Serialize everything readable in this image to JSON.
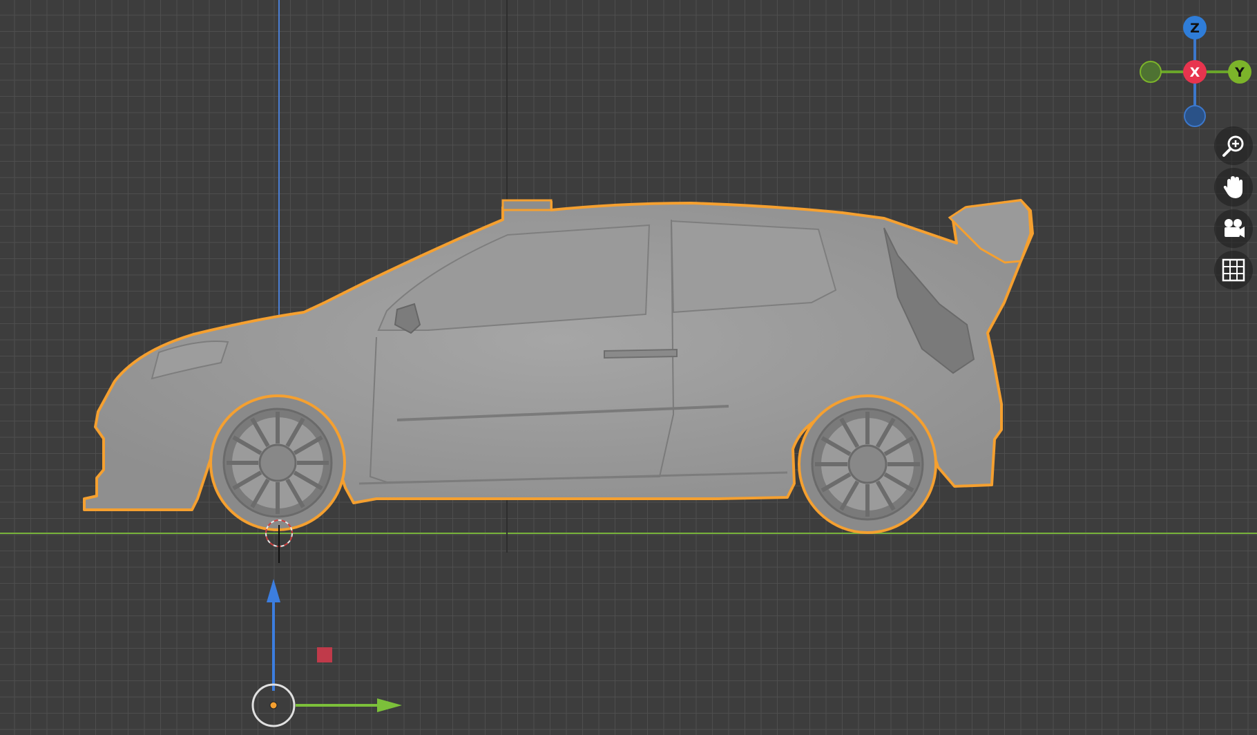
{
  "viewport": {
    "background": "#3d3d3d",
    "grid_color": "#505050"
  },
  "gizmo": {
    "z_label": "Z",
    "x_label": "X",
    "y_label": "Y",
    "z_color": "#2f7dd8",
    "x_color": "#e8344e",
    "y_color": "#7cb42a"
  },
  "nav_buttons": [
    {
      "name": "zoom",
      "icon": "zoom-magnifier-icon"
    },
    {
      "name": "pan",
      "icon": "hand-icon"
    },
    {
      "name": "camera",
      "icon": "camera-icon"
    },
    {
      "name": "perspective-toggle",
      "icon": "grid-icon"
    }
  ],
  "selection": {
    "outline_color": "#f5a030"
  }
}
